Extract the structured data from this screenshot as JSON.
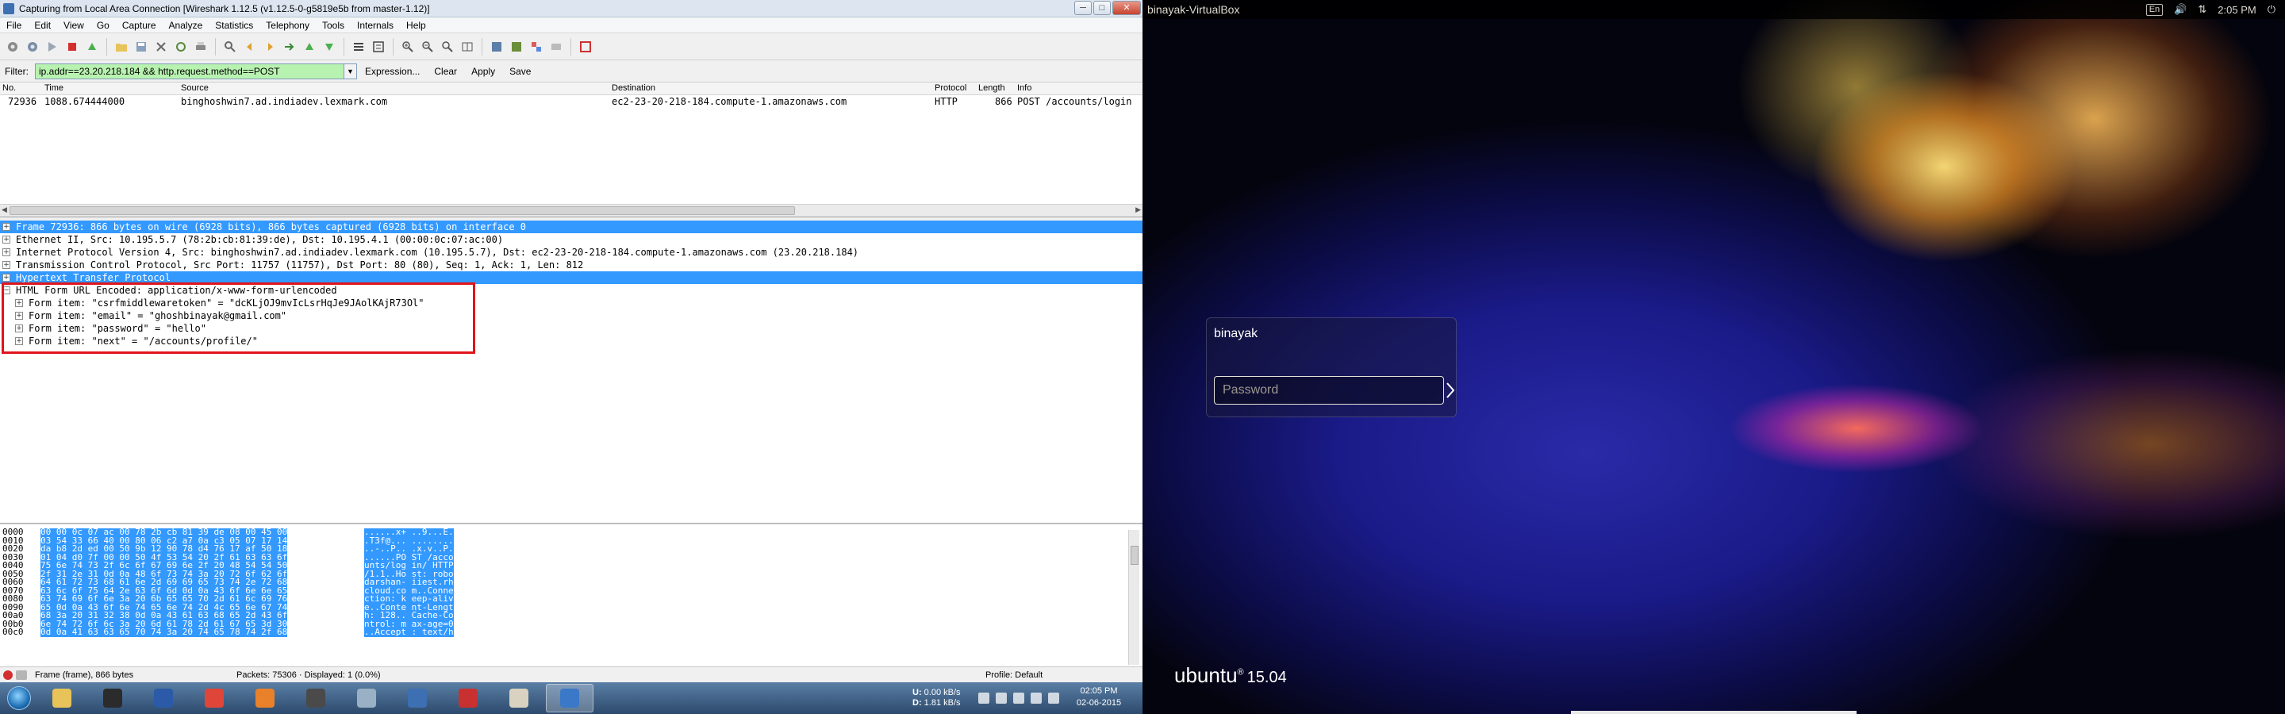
{
  "window": {
    "title": "Capturing from Local Area Connection   [Wireshark 1.12.5  (v1.12.5-0-g5819e5b from master-1.12)]",
    "controls": [
      "─",
      "□",
      "✕"
    ]
  },
  "menu": [
    "File",
    "Edit",
    "View",
    "Go",
    "Capture",
    "Analyze",
    "Statistics",
    "Telephony",
    "Tools",
    "Internals",
    "Help"
  ],
  "filter": {
    "label": "Filter:",
    "value": "ip.addr==23.20.218.184 && http.request.method==POST",
    "buttons": [
      "Expression...",
      "Clear",
      "Apply",
      "Save"
    ],
    "valid_color": "#b8f2b0"
  },
  "packet_list": {
    "columns": [
      "No.",
      "Time",
      "Source",
      "Destination",
      "Protocol",
      "Length",
      "Info"
    ],
    "rows": [
      {
        "no": "72936",
        "time": "1088.674444000",
        "source": "binghoshwin7.ad.indiadev.lexmark.com",
        "destination": "ec2-23-20-218-184.compute-1.amazonaws.com",
        "protocol": "HTTP",
        "length": "866",
        "info": "POST /accounts/login"
      }
    ]
  },
  "details": [
    {
      "text": "Frame 72936: 866 bytes on wire (6928 bits), 866 bytes captured (6928 bits) on interface 0",
      "selected": true,
      "exp": "+"
    },
    {
      "text": "Ethernet II, Src: 10.195.5.7 (78:2b:cb:81:39:de), Dst: 10.195.4.1 (00:00:0c:07:ac:00)",
      "selected": false,
      "exp": "+"
    },
    {
      "text": "Internet Protocol Version 4, Src: binghoshwin7.ad.indiadev.lexmark.com (10.195.5.7), Dst: ec2-23-20-218-184.compute-1.amazonaws.com (23.20.218.184)",
      "selected": false,
      "exp": "+"
    },
    {
      "text": "Transmission Control Protocol, Src Port: 11757 (11757), Dst Port: 80 (80), Seq: 1, Ack: 1, Len: 812",
      "selected": false,
      "exp": "+"
    },
    {
      "text": "Hypertext Transfer Protocol",
      "selected": true,
      "exp": "+"
    },
    {
      "text": "HTML Form URL Encoded: application/x-www-form-urlencoded",
      "selected": false,
      "exp": "−"
    },
    {
      "text": "Form item: \"csrfmiddlewaretoken\" = \"dcKLjOJ9mvIcLsrHqJe9JAolKAjR73Ol\"",
      "selected": false,
      "exp": "+",
      "child": true
    },
    {
      "text": "Form item: \"email\" = \"ghoshbinayak@gmail.com\"",
      "selected": false,
      "exp": "+",
      "child": true
    },
    {
      "text": "Form item: \"password\" = \"hello\"",
      "selected": false,
      "exp": "+",
      "child": true
    },
    {
      "text": "Form item: \"next\" = \"/accounts/profile/\"",
      "selected": false,
      "exp": "+",
      "child": true
    }
  ],
  "hex": [
    {
      "off": "0000",
      "bytes": "00 00 0c 07 ac 00 78 2b  cb 81 39 de 08 00 45 00",
      "ascii": "......x+ ..9...E."
    },
    {
      "off": "0010",
      "bytes": "03 54 33 66 40 00 80 06  c2 a7 0a c3 05 07 17 14",
      "ascii": ".T3f@... ........"
    },
    {
      "off": "0020",
      "bytes": "da b8 2d ed 00 50 9b 12  90 78 d4 76 17 af 50 18",
      "ascii": "..-..P.. .x.v..P."
    },
    {
      "off": "0030",
      "bytes": "01 04 d0 7f 00 00 50 4f  53 54 20 2f 61 63 63 6f",
      "ascii": "......PO ST /acco"
    },
    {
      "off": "0040",
      "bytes": "75 6e 74 73 2f 6c 6f 67  69 6e 2f 20 48 54 54 50",
      "ascii": "unts/log in/ HTTP"
    },
    {
      "off": "0050",
      "bytes": "2f 31 2e 31 0d 0a 48 6f  73 74 3a 20 72 6f 62 6f",
      "ascii": "/1.1..Ho st: robo"
    },
    {
      "off": "0060",
      "bytes": "64 61 72 73 68 61 6e 2d  69 69 65 73 74 2e 72 68",
      "ascii": "darshan- iiest.rh"
    },
    {
      "off": "0070",
      "bytes": "63 6c 6f 75 64 2e 63 6f  6d 0d 0a 43 6f 6e 6e 65",
      "ascii": "cloud.co m..Conne"
    },
    {
      "off": "0080",
      "bytes": "63 74 69 6f 6e 3a 20 6b  65 65 70 2d 61 6c 69 76",
      "ascii": "ction: k eep-aliv"
    },
    {
      "off": "0090",
      "bytes": "65 0d 0a 43 6f 6e 74 65  6e 74 2d 4c 65 6e 67 74",
      "ascii": "e..Conte nt-Lengt"
    },
    {
      "off": "00a0",
      "bytes": "68 3a 20 31 32 38 0d 0a  43 61 63 68 65 2d 43 6f",
      "ascii": "h: 128.. Cache-Co"
    },
    {
      "off": "00b0",
      "bytes": "6e 74 72 6f 6c 3a 20 6d  61 78 2d 61 67 65 3d 30",
      "ascii": "ntrol: m ax-age=0"
    },
    {
      "off": "00c0",
      "bytes": "0d 0a 41 63 63 65 70 74  3a 20 74 65 78 74 2f 68",
      "ascii": "..Accept : text/h"
    }
  ],
  "status": {
    "frame": "Frame (frame), 866 bytes",
    "packets": "Packets: 75306 · Displayed: 1 (0.0%)",
    "profile": "Profile: Default"
  },
  "taskbar": {
    "apps": [
      {
        "name": "explorer",
        "color": "#e8c35a"
      },
      {
        "name": "intellij",
        "color": "#2b2b2b"
      },
      {
        "name": "powershell",
        "color": "#2a5aa8"
      },
      {
        "name": "chrome",
        "color": "#e0453a"
      },
      {
        "name": "firefox",
        "color": "#e8812a"
      },
      {
        "name": "sublime",
        "color": "#4a4a4a"
      },
      {
        "name": "network",
        "color": "#9ab0c4"
      },
      {
        "name": "virtualbox",
        "color": "#3d6fb3"
      },
      {
        "name": "filezilla",
        "color": "#c93030"
      },
      {
        "name": "paint",
        "color": "#d9d2c0"
      },
      {
        "name": "wireshark",
        "color": "#3a78c8",
        "active": true
      }
    ],
    "net_up_label": "U:",
    "net_up": "0.00 kB/s",
    "net_down_label": "D:",
    "net_down": "1.81 kB/s",
    "time": "02:05 PM",
    "date": "02-06-2015"
  },
  "vm": {
    "host": "binayak-VirtualBox",
    "keyboard": "En",
    "time": "2:05 PM",
    "username": "binayak",
    "password_placeholder": "Password",
    "distro": "ubuntu",
    "version": "15.04"
  }
}
